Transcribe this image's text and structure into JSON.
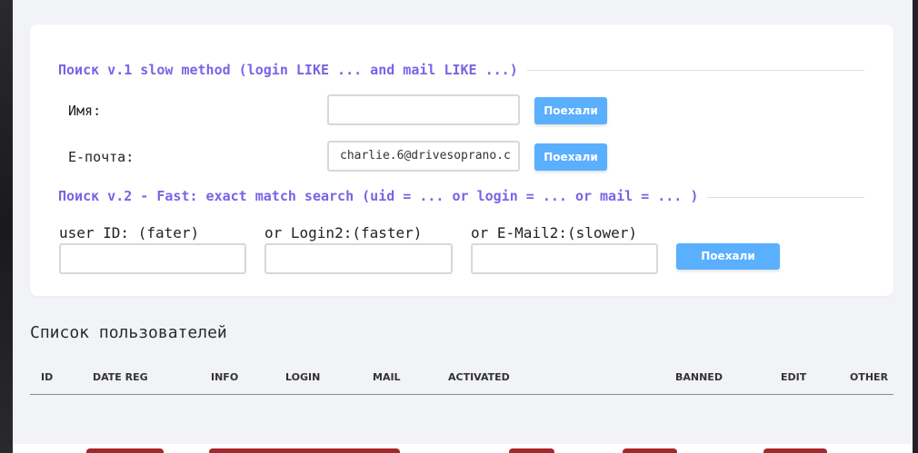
{
  "search_v1": {
    "legend": "Поиск v.1 slow method (login LIKE ... and mail LIKE ...)",
    "name_label": "Имя:",
    "name_value": "",
    "email_label": "E-почта:",
    "email_value": "charlie.6@drivesoprano.c",
    "go_label": "Поехали"
  },
  "search_v2": {
    "legend": "Поиск v.2 - Fast: exact match search (uid = ... or login = ... or mail = ... )",
    "uid_label": "user ID: (fater)",
    "login_label": "or Login2:(faster)",
    "mail_label": "or E-Mail2:(slower)",
    "go_label": "Поехали"
  },
  "users": {
    "title": "Список пользователей",
    "columns": [
      "ID",
      "DATE REG",
      "INFO",
      "LOGIN",
      "MAIL",
      "ACTIVATED",
      "BANNED",
      "EDIT",
      "OTHER"
    ]
  },
  "colors": {
    "legend": "#7a63e6",
    "button": "#5aafff",
    "page_bg": "#f2f3f7"
  }
}
